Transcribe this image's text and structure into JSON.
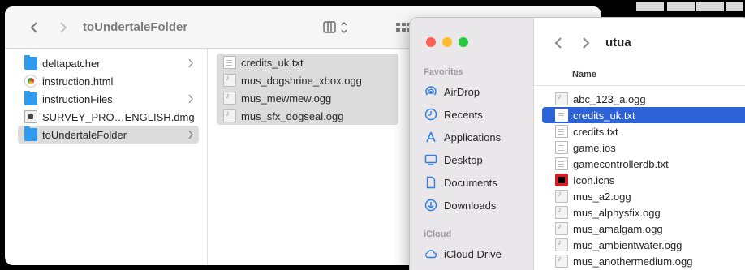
{
  "menubar": {
    "icons": [
      "status-icon-a",
      "status-icon-b",
      "status-icon-c",
      "status-icon-d"
    ]
  },
  "back_window": {
    "title": "toUndertaleFolder",
    "column1": [
      {
        "name": "deltapatcher",
        "kind": "folder",
        "has_children": true,
        "selected": false
      },
      {
        "name": "instruction.html",
        "kind": "html",
        "has_children": false,
        "selected": false
      },
      {
        "name": "instructionFiles",
        "kind": "folder",
        "has_children": true,
        "selected": false
      },
      {
        "name": "SURVEY_PRO…ENGLISH.dmg",
        "kind": "dmg",
        "has_children": false,
        "selected": false
      },
      {
        "name": "toUndertaleFolder",
        "kind": "folder",
        "has_children": true,
        "selected": true
      }
    ],
    "column2": [
      {
        "name": "credits_uk.txt",
        "kind": "txt"
      },
      {
        "name": "mus_dogshrine_xbox.ogg",
        "kind": "audio"
      },
      {
        "name": "mus_mewmew.ogg",
        "kind": "audio"
      },
      {
        "name": "mus_sfx_dogseal.ogg",
        "kind": "audio"
      }
    ]
  },
  "front_window": {
    "title": "utua",
    "favorites_header": "Favorites",
    "favorites": [
      {
        "label": "AirDrop",
        "icon": "airdrop-icon"
      },
      {
        "label": "Recents",
        "icon": "clock-icon"
      },
      {
        "label": "Applications",
        "icon": "applications-icon"
      },
      {
        "label": "Desktop",
        "icon": "desktop-icon"
      },
      {
        "label": "Documents",
        "icon": "document-icon"
      },
      {
        "label": "Downloads",
        "icon": "download-icon"
      }
    ],
    "icloud_header": "iCloud",
    "icloud": [
      {
        "label": "iCloud Drive",
        "icon": "cloud-icon"
      }
    ],
    "column_header": "Name",
    "files": [
      {
        "name": "abc_123_a.ogg",
        "kind": "audio",
        "selected": false
      },
      {
        "name": "credits_uk.txt",
        "kind": "txt",
        "selected": true
      },
      {
        "name": "credits.txt",
        "kind": "txt",
        "selected": false
      },
      {
        "name": "game.ios",
        "kind": "blank",
        "selected": false
      },
      {
        "name": "gamecontrollerdb.txt",
        "kind": "txt",
        "selected": false
      },
      {
        "name": "Icon.icns",
        "kind": "icns",
        "selected": false
      },
      {
        "name": "mus_a2.ogg",
        "kind": "audio",
        "selected": false
      },
      {
        "name": "mus_alphysfix.ogg",
        "kind": "audio",
        "selected": false
      },
      {
        "name": "mus_amalgam.ogg",
        "kind": "audio",
        "selected": false
      },
      {
        "name": "mus_ambientwater.ogg",
        "kind": "audio",
        "selected": false
      },
      {
        "name": "mus_anothermedium.ogg",
        "kind": "audio",
        "selected": false
      }
    ]
  },
  "colors": {
    "selection_blue": "#2d63d8",
    "selection_gray": "#dcdcdc",
    "folder_blue": "#2f9bea",
    "close_red": "#fe5f57",
    "minimize_yellow": "#febc2e",
    "zoom_green": "#28c840"
  }
}
